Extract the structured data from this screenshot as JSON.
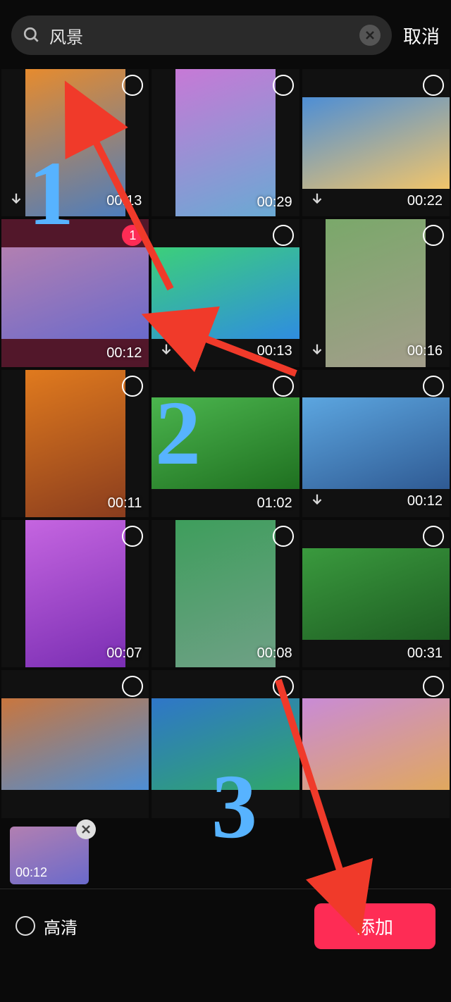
{
  "search": {
    "value": "风景",
    "placeholder": "",
    "cancel": "取消"
  },
  "cells": [
    {
      "duration": "00:13",
      "download": true,
      "selected": false,
      "shape": "tall",
      "g1": "#e68b2e",
      "g2": "#4d7dbd"
    },
    {
      "duration": "00:29",
      "download": false,
      "selected": false,
      "shape": "tall",
      "g1": "#c779d6",
      "g2": "#6aa9d3"
    },
    {
      "duration": "00:22",
      "download": true,
      "selected": false,
      "shape": "wide",
      "g1": "#4d8ed5",
      "g2": "#f2c56a"
    },
    {
      "duration": "00:12",
      "download": false,
      "selected": true,
      "shape": "wide",
      "g1": "#b27fb1",
      "g2": "#6a6acb",
      "order": "1"
    },
    {
      "duration": "00:13",
      "download": true,
      "selected": false,
      "shape": "wide",
      "g1": "#3ccf7a",
      "g2": "#2f8de0"
    },
    {
      "duration": "00:16",
      "download": true,
      "selected": false,
      "shape": "tall",
      "g1": "#7aa86a",
      "g2": "#a39d8b"
    },
    {
      "duration": "00:11",
      "download": false,
      "selected": false,
      "shape": "tall",
      "g1": "#e07a1e",
      "g2": "#8a3d1e"
    },
    {
      "duration": "01:02",
      "download": false,
      "selected": false,
      "shape": "wide",
      "g1": "#4bb54e",
      "g2": "#1f7020"
    },
    {
      "duration": "00:12",
      "download": true,
      "selected": false,
      "shape": "wide",
      "g1": "#5ca6e0",
      "g2": "#2f5a93"
    },
    {
      "duration": "00:07",
      "download": false,
      "selected": false,
      "shape": "tall",
      "g1": "#c565e0",
      "g2": "#7a2eb3"
    },
    {
      "duration": "00:08",
      "download": false,
      "selected": false,
      "shape": "tall",
      "g1": "#3e9e5c",
      "g2": "#6fa086"
    },
    {
      "duration": "00:31",
      "download": false,
      "selected": false,
      "shape": "wide",
      "g1": "#3a9a3e",
      "g2": "#1e5d22"
    },
    {
      "duration": "",
      "download": false,
      "selected": false,
      "shape": "wide",
      "g1": "#c9763e",
      "g2": "#4d8ed5"
    },
    {
      "duration": "",
      "download": false,
      "selected": false,
      "shape": "wide",
      "g1": "#2f76c9",
      "g2": "#2fa76a"
    },
    {
      "duration": "",
      "download": false,
      "selected": false,
      "shape": "wide",
      "g1": "#c98bd6",
      "g2": "#e0a85e"
    }
  ],
  "tray": {
    "items": [
      {
        "duration": "00:12",
        "g1": "#b27fb1",
        "g2": "#6a6acb"
      }
    ]
  },
  "bottom": {
    "hd": "高清",
    "add": "添加"
  },
  "annotations": {
    "n1": "1",
    "n2": "2",
    "n3": "3"
  }
}
